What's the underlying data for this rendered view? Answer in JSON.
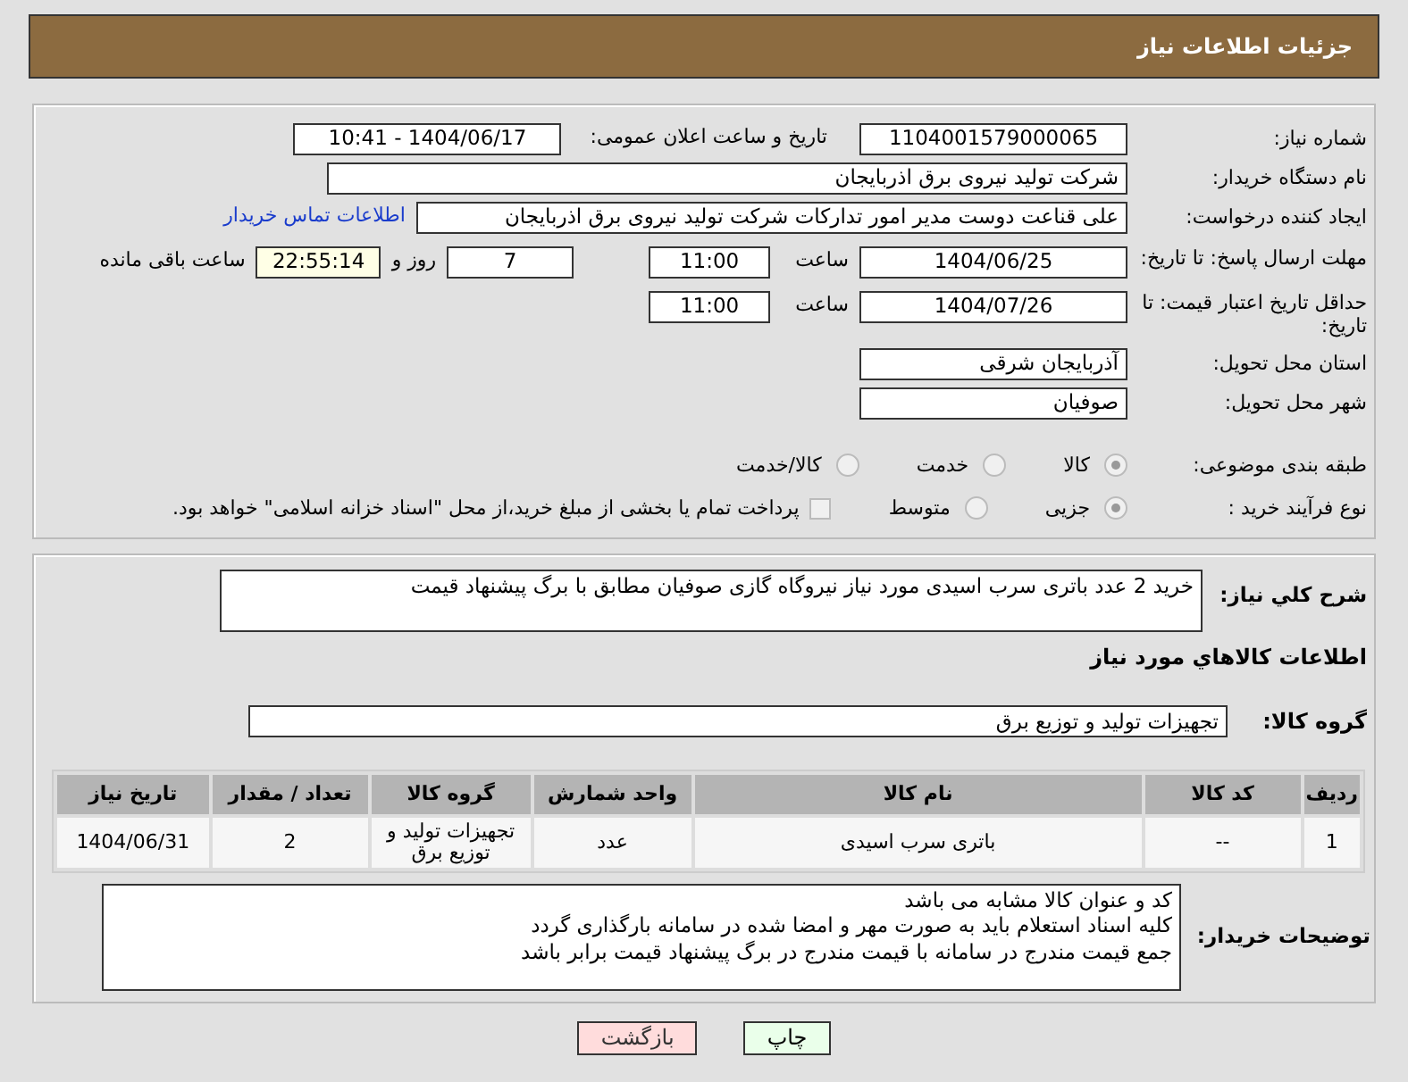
{
  "header": {
    "title": "جزئیات اطلاعات نیاز"
  },
  "need_number": {
    "label": "شماره نیاز:",
    "value": "1104001579000065"
  },
  "announce": {
    "label": "تاریخ و ساعت اعلان عمومی:",
    "value": "1404/06/17 - 10:41"
  },
  "buyer_org": {
    "label": "نام دستگاه خریدار:",
    "value": "شرکت تولید نیروی برق اذربایجان"
  },
  "requester": {
    "label": "ایجاد کننده درخواست:",
    "value": "علی قناعت دوست مدیر امور تدارکات شرکت تولید نیروی برق اذربایجان",
    "link": "اطلاعات تماس خریدار"
  },
  "deadline": {
    "label": "مهلت ارسال پاسخ: تا تاریخ:",
    "date": "1404/06/25",
    "time_label": "ساعت",
    "time": "11:00",
    "days": "7",
    "days_label": "روز و",
    "remaining": "22:55:14",
    "remaining_label": "ساعت باقی مانده"
  },
  "validity": {
    "label": "حداقل تاریخ اعتبار قیمت: تا تاریخ:",
    "date": "1404/07/26",
    "time_label": "ساعت",
    "time": "11:00"
  },
  "province": {
    "label": "استان محل تحویل:",
    "value": "آذربایجان شرقی"
  },
  "city": {
    "label": "شهر محل تحویل:",
    "value": "صوفیان"
  },
  "category": {
    "label": "طبقه بندی موضوعی:",
    "options": [
      {
        "label": "کالا",
        "selected": true
      },
      {
        "label": "خدمت",
        "selected": false
      },
      {
        "label": "کالا/خدمت",
        "selected": false
      }
    ]
  },
  "process": {
    "label": "نوع فرآیند خرید :",
    "options": [
      {
        "label": "جزیی",
        "selected": true
      },
      {
        "label": "متوسط",
        "selected": false
      }
    ],
    "payment": {
      "label": "پرداخت تمام یا بخشی از مبلغ خرید،از محل \"اسناد خزانه اسلامی\" خواهد بود.",
      "checked": false
    }
  },
  "description": {
    "label": "شرح کلي نیاز:",
    "value": "خرید 2 عدد باتری سرب اسیدی مورد نیاز نیروگاه گازی صوفیان مطابق با برگ پیشنهاد قیمت"
  },
  "goods_title": "اطلاعات کالاهاي مورد نياز",
  "goods_group": {
    "label": "گروه کالا:",
    "value": "تجهیزات تولید و توزیع برق"
  },
  "table": {
    "columns": [
      "ردیف",
      "کد کالا",
      "نام کالا",
      "واحد شمارش",
      "گروه کالا",
      "تعداد / مقدار",
      "تاریخ نیاز"
    ],
    "rows": [
      [
        "1",
        "--",
        "باتری سرب اسیدی",
        "عدد",
        "تجهیزات تولید و توزیع برق",
        "2",
        "1404/06/31"
      ]
    ]
  },
  "buyer_notes": {
    "label": "توضیحات خریدار:",
    "lines": [
      "کد و عنوان کالا مشابه می باشد",
      "کلیه اسناد استعلام باید به صورت مهر و امضا شده در سامانه بارگذاری گردد",
      "جمع قیمت مندرج در سامانه با قیمت مندرج در برگ پیشنهاد قیمت برابر باشد"
    ]
  },
  "buttons": [
    {
      "kind": "print",
      "label": "چاپ"
    },
    {
      "kind": "back",
      "label": "بازگشت"
    }
  ]
}
